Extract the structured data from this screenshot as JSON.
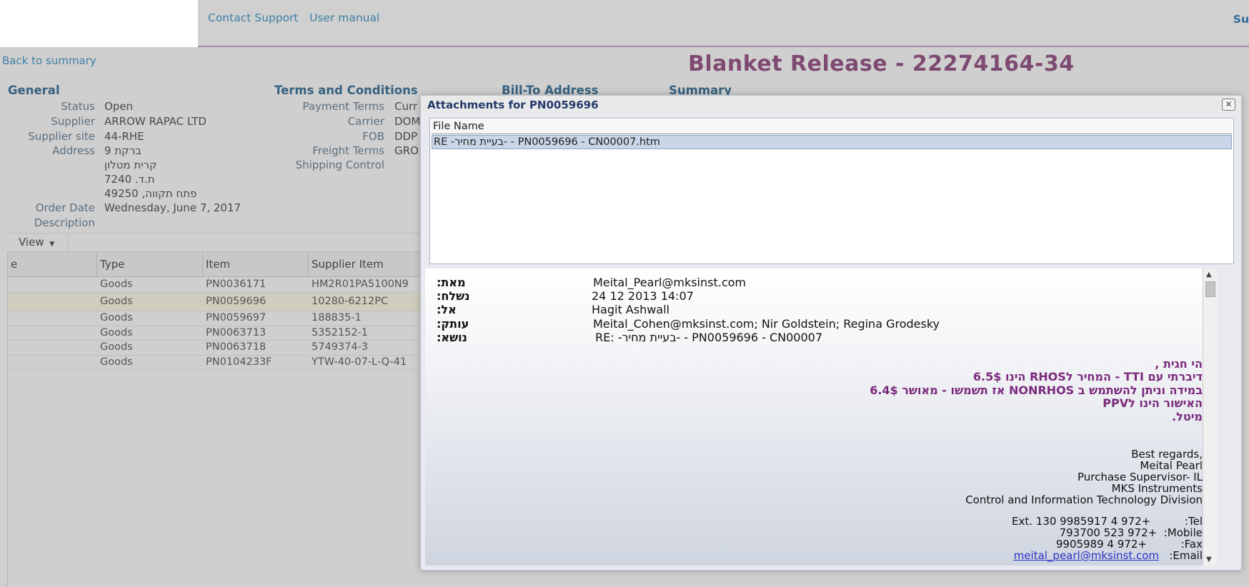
{
  "header": {
    "contact_support": "Contact Support",
    "user_manual": "User manual",
    "right_cutoff": "Su"
  },
  "back_link": "Back to summary",
  "page_title": "Blanket Release - 22274164-34",
  "sections": {
    "general": "General",
    "terms": "Terms and Conditions",
    "billto": "Bill-To Address",
    "summary": "Summary"
  },
  "general": {
    "status_label": "Status",
    "status": "Open",
    "supplier_label": "Supplier",
    "supplier": "ARROW RAPAC LTD",
    "site_label": "Supplier site",
    "site": "44-RHE",
    "address_label": "Address",
    "address_lines": [
      "ברקת 9",
      "קרית מטלון",
      "ת.ד. 7240",
      "פתח תקווה, 49250"
    ],
    "order_date_label": "Order Date",
    "order_date": "Wednesday, June 7, 2017",
    "description_label": "Description"
  },
  "terms": {
    "payment_label": "Payment Terms",
    "payment": "Curr",
    "carrier_label": "Carrier",
    "carrier": "DOM",
    "fob_label": "FOB",
    "fob": "DDP",
    "freight_label": "Freight Terms",
    "freight": "GRO",
    "shipping_label": "Shipping Control"
  },
  "view_button": "View",
  "grid": {
    "columns": [
      "e",
      "Type",
      "Item",
      "Supplier Item"
    ],
    "rows": [
      {
        "type": "Goods",
        "item": "PN0036171",
        "supplier_item": "HM2R01PA5100N9"
      },
      {
        "type": "Goods",
        "item": "PN0059696",
        "supplier_item": "10280-6212PC"
      },
      {
        "type": "Goods",
        "item": "PN0059697",
        "supplier_item": "188835-1"
      },
      {
        "type": "Goods",
        "item": "PN0063713",
        "supplier_item": "5352152-1"
      },
      {
        "type": "Goods",
        "item": "PN0063718",
        "supplier_item": "5749374-3"
      },
      {
        "type": "Goods",
        "item": "PN0104233F",
        "supplier_item": "YTW-40-07-L-Q-41"
      }
    ]
  },
  "dialog": {
    "title": "Attachments for PN0059696",
    "close": "✕",
    "file_col": "File Name",
    "file_row": "RE -בעיית מחיר- - PN0059696 - CN00007.htm",
    "email": {
      "from_label": "מאת:",
      "from": "Meital_Pearl@mksinst.com",
      "sent_label": "נשלח:",
      "sent": "24 12 2013 14:07",
      "to_label": "אל:",
      "to": "Hagit Ashwall",
      "cc_label": "עותק:",
      "cc": "Meital_Cohen@mksinst.com; Nir Goldstein; Regina Grodesky",
      "subject_label": "נושא:",
      "subject": "RE: -בעיית מחיר- - PN0059696 - CN00007",
      "body_lines": [
        "הי חגית ,",
        "דיברתי עם TTI - המחיר לRHOS הינו 6.5$",
        "במידה וניתן להשתמש ב NONRHOS אז תשמשו - מאושר 6.4$",
        "האישור הינו לPPV",
        "מיטל."
      ],
      "sig_lines": [
        "Best regards,",
        "Meital Pearl",
        "Purchase Supervisor- IL",
        "MKS Instruments",
        "Control and Information Technology Division"
      ],
      "tel_line": "Ext. 130 9985917 4 972+          :Tel",
      "mobile_line": "793700 523 972+  :Mobile",
      "fax_line": "9905989 4 972+          :Fax",
      "email_value": "meital_pearl@mksinst.com",
      "email_label": "   :Email"
    }
  }
}
